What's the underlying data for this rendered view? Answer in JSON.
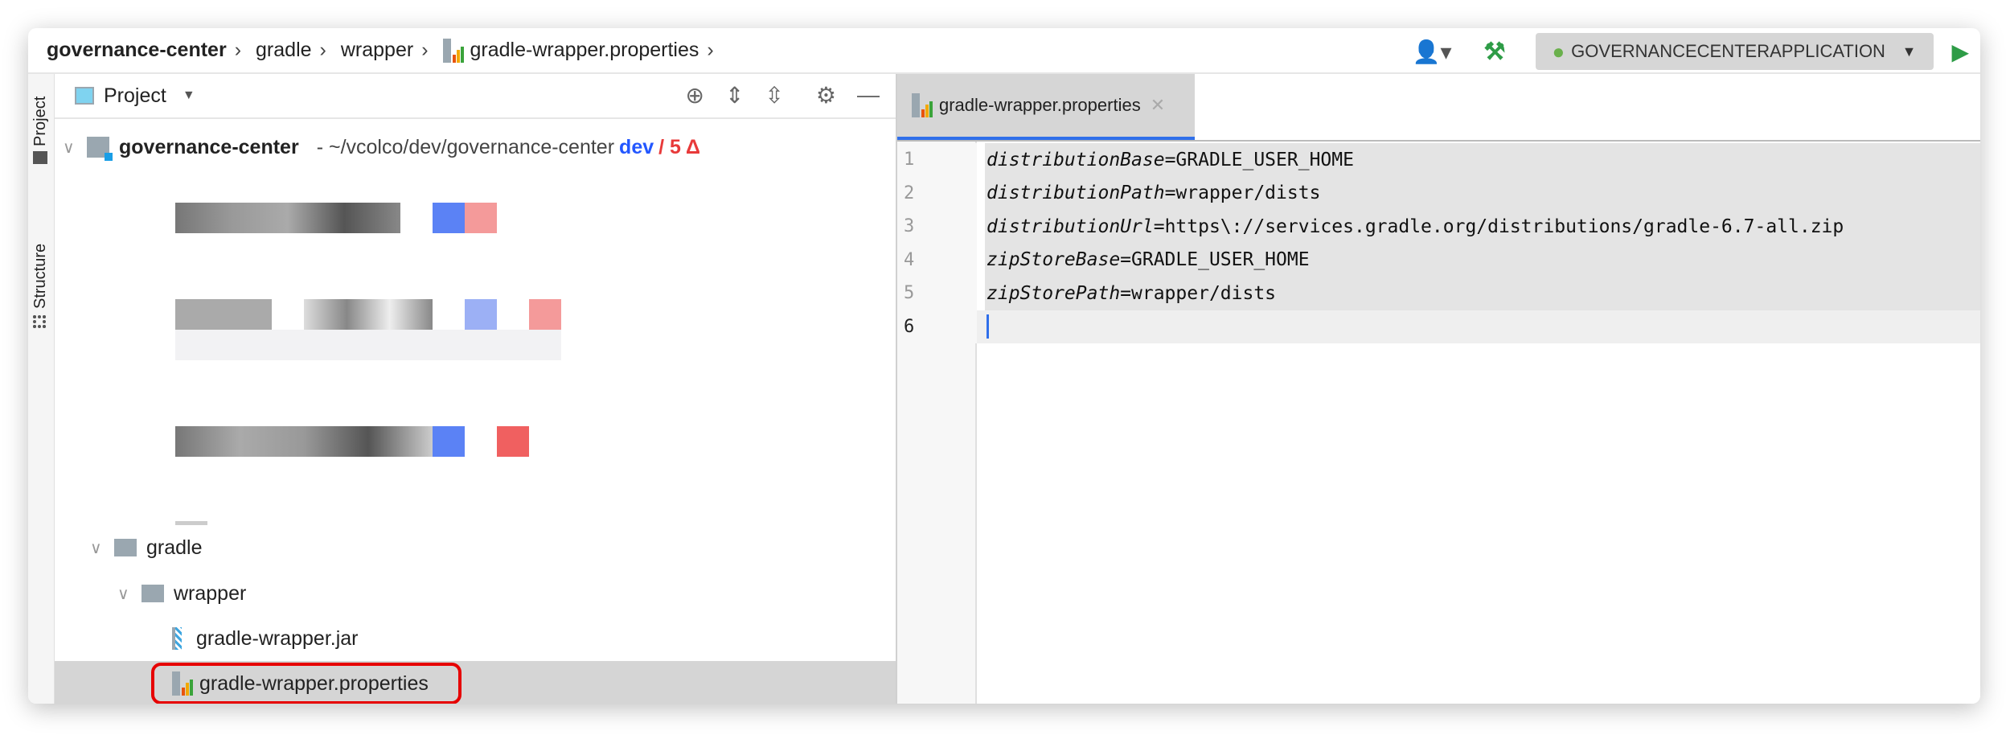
{
  "breadcrumb": [
    "governance-center",
    "gradle",
    "wrapper",
    "gradle-wrapper.properties"
  ],
  "toolbar": {
    "run_config": "GOVERNANCECENTERAPPLICATION",
    "icons": [
      "user-icon",
      "hammer-build-icon",
      "spring-boot-icon",
      "run-icon"
    ]
  },
  "side_stripe": {
    "project": "Project",
    "structure": "Structure"
  },
  "project_panel": {
    "title": "Project",
    "root": {
      "name": "governance-center",
      "path": "- ~/vcolco/dev/governance-center",
      "branch": "dev",
      "changes": "/ 5 Δ"
    },
    "items": [
      {
        "name": "gradle",
        "type": "folder"
      },
      {
        "name": "wrapper",
        "type": "folder"
      },
      {
        "name": "gradle-wrapper.jar",
        "type": "jar"
      },
      {
        "name": "gradle-wrapper.properties",
        "type": "properties",
        "selected": true,
        "highlighted": true
      }
    ]
  },
  "editor": {
    "tab": "gradle-wrapper.properties",
    "lines": [
      {
        "n": "1",
        "key": "distributionBase",
        "value": "=GRADLE_USER_HOME"
      },
      {
        "n": "2",
        "key": "distributionPath",
        "value": "=wrapper/dists"
      },
      {
        "n": "3",
        "key": "distributionUrl",
        "value": "=https\\://services.gradle.org/distributions/gradle-6.7-all.zip"
      },
      {
        "n": "4",
        "key": "zipStoreBase",
        "value": "=GRADLE_USER_HOME"
      },
      {
        "n": "5",
        "key": "zipStorePath",
        "value": "=wrapper/dists"
      },
      {
        "n": "6",
        "key": "",
        "value": ""
      }
    ],
    "current_line": 6
  },
  "colors": {
    "accent": "#2f6fea",
    "highlight_box": "#e60000",
    "branch": "#2357ff",
    "changes": "#e83a3a"
  }
}
